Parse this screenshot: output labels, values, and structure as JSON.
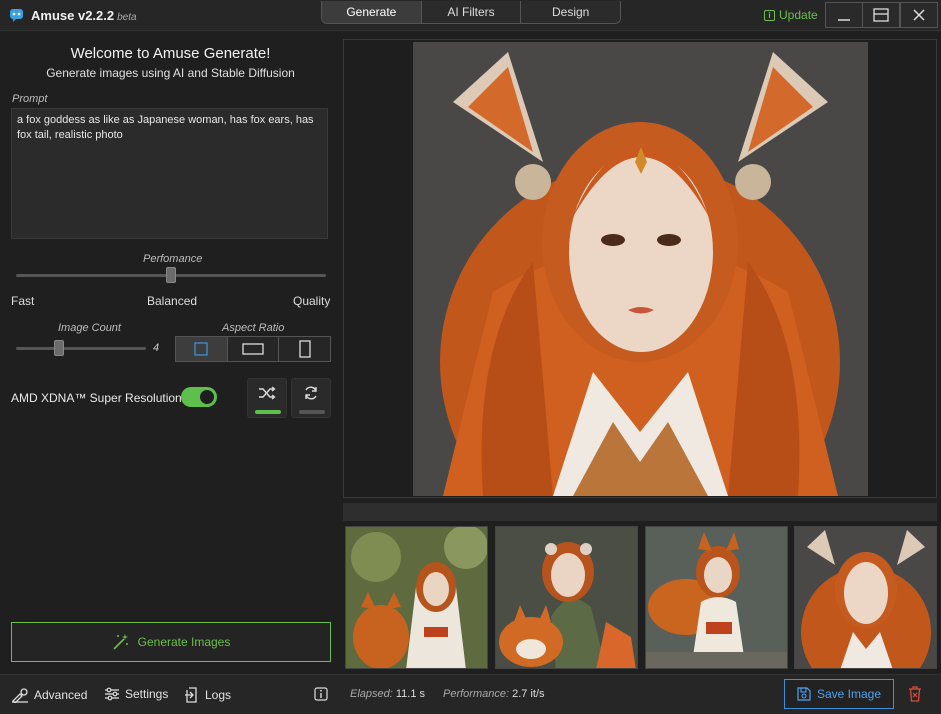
{
  "app": {
    "title": "Amuse v2.2.2",
    "beta": "beta"
  },
  "tabs": [
    {
      "label": "Generate",
      "active": true
    },
    {
      "label": "AI Filters",
      "active": false
    },
    {
      "label": "Design",
      "active": false
    }
  ],
  "update_label": "Update",
  "left": {
    "welcome": "Welcome to Amuse Generate!",
    "subtitle": "Generate images using AI and Stable Diffusion",
    "prompt_label": "Prompt",
    "prompt_value": "a fox goddess as like as Japanese woman, has fox ears, has fox tail, realistic photo",
    "performance": {
      "label": "Perfomance",
      "fast": "Fast",
      "balanced": "Balanced",
      "quality": "Quality",
      "level": 0.5
    },
    "image_count": {
      "label": "Image Count",
      "value": "4",
      "level": 0.33
    },
    "aspect_ratio": {
      "label": "Aspect Ratio",
      "options": [
        "square-icon",
        "landscape-icon",
        "portrait-icon"
      ],
      "selected": 0
    },
    "amd_label": "AMD XDNA™ Super Resolution",
    "amd_enabled": true,
    "generate_label": "Generate Images"
  },
  "bottom": {
    "advanced": "Advanced",
    "settings": "Settings",
    "logs": "Logs",
    "elapsed_label": "Elapsed:",
    "elapsed_value": "11.1 s",
    "performance_label": "Performance:",
    "performance_value": "2.7 it/s",
    "save_label": "Save Image"
  },
  "colors": {
    "accent_green": "#6cc04a",
    "accent_blue": "#3d8fd6",
    "delete_red": "#e04a3a"
  }
}
